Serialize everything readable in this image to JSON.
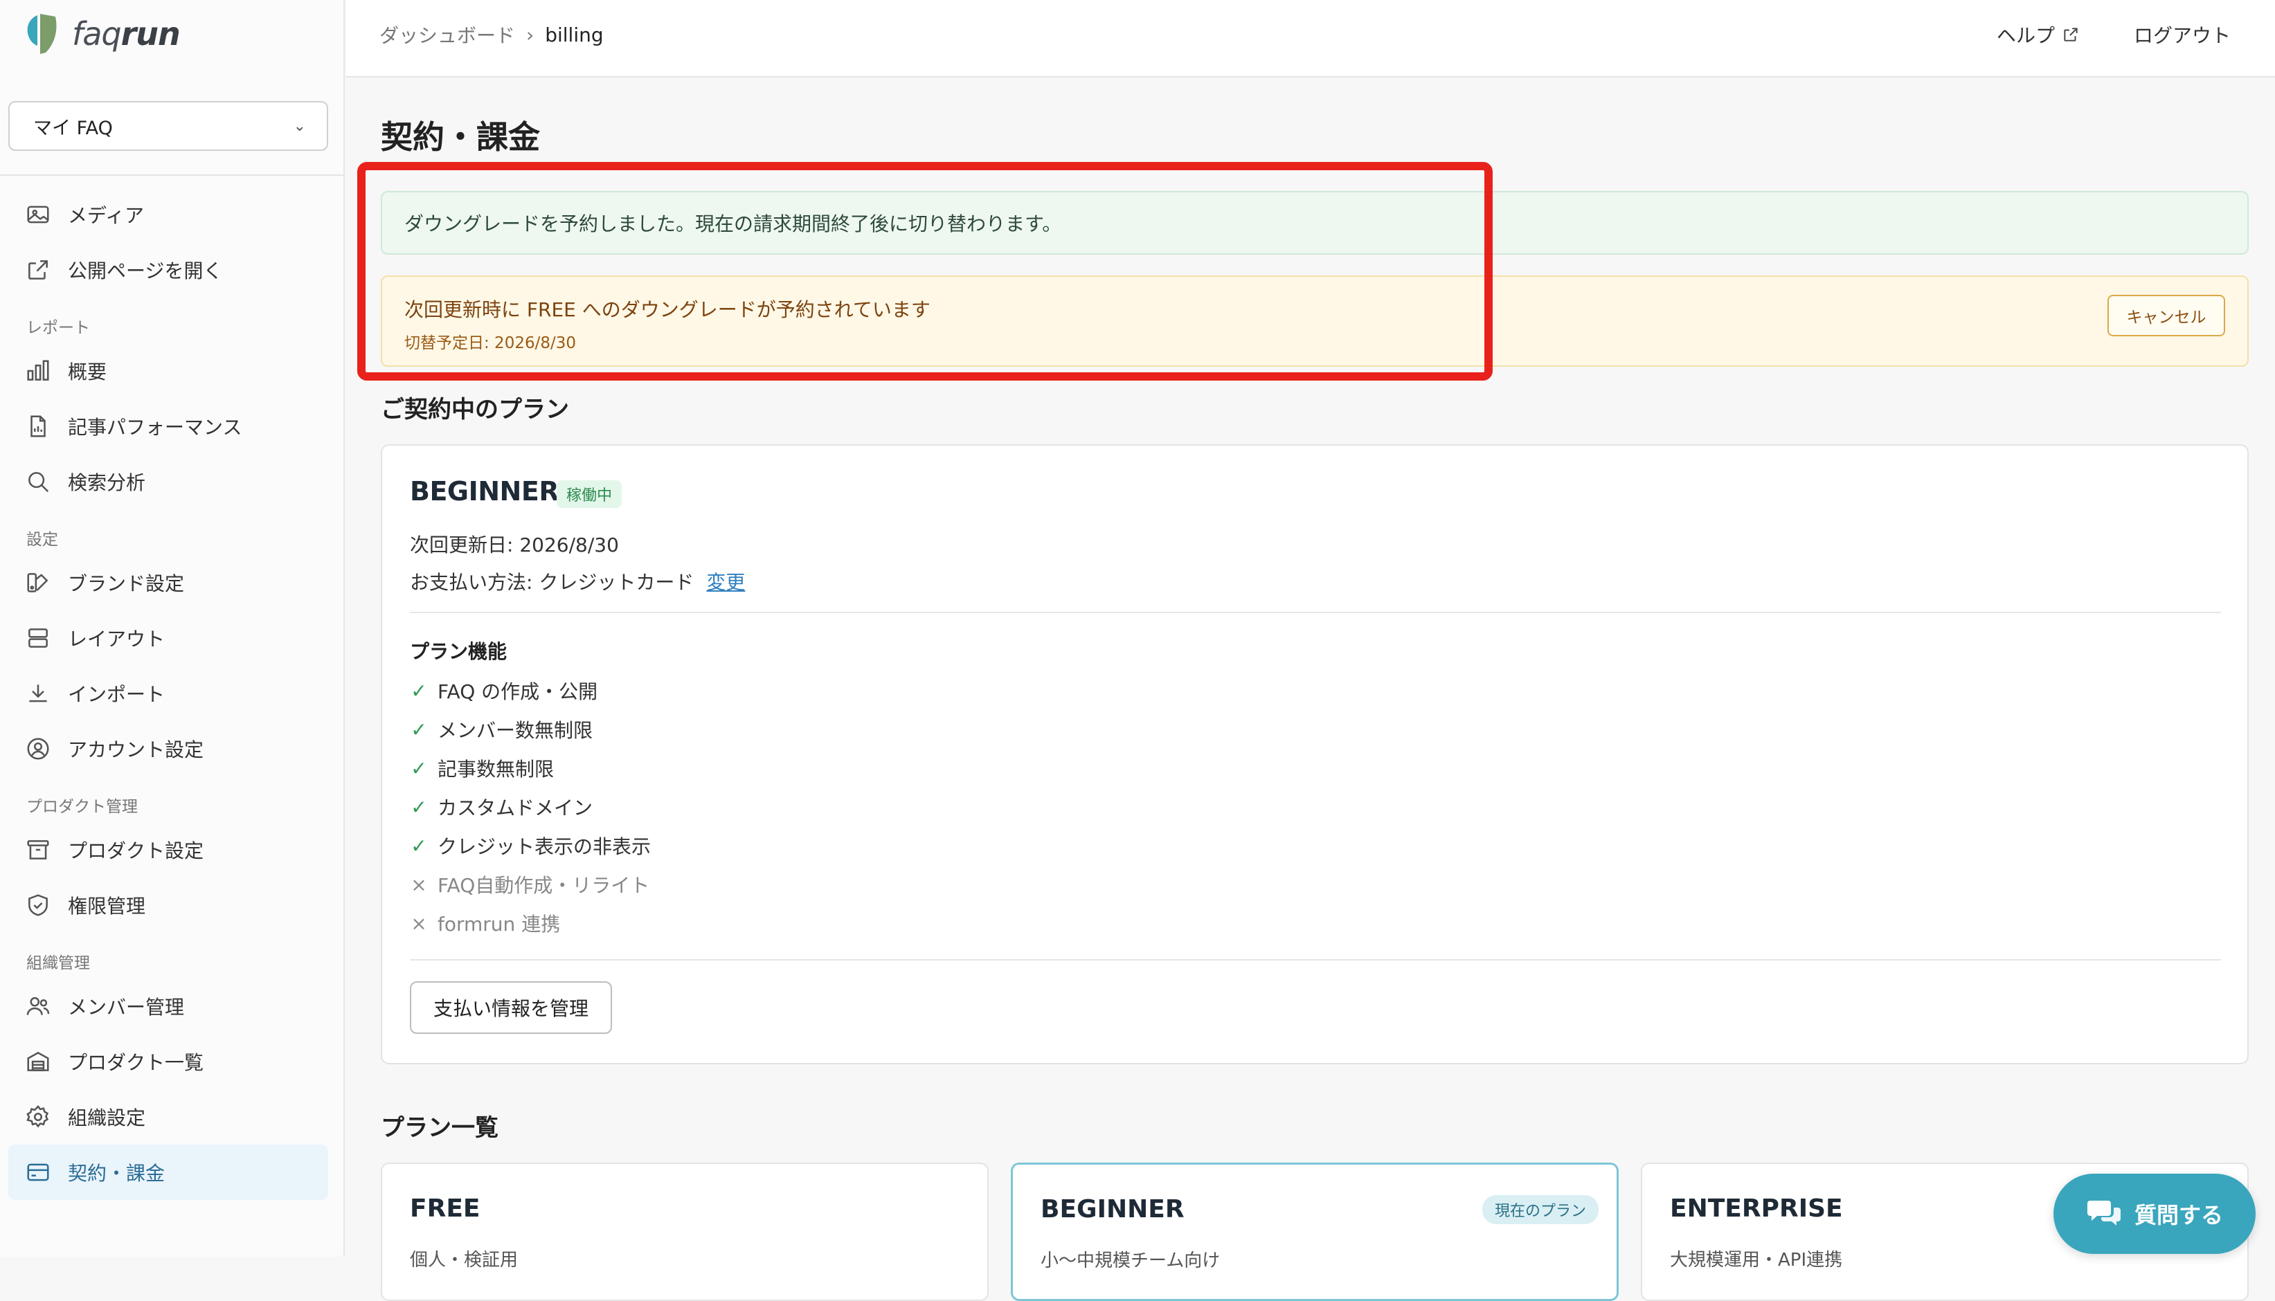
{
  "brand": {
    "logo_text_light": "faq",
    "logo_text_bold": "run",
    "accent": "#3aa6bd"
  },
  "sidebar": {
    "faq_select": {
      "value": "マイ FAQ"
    },
    "items_top": [
      {
        "label": "メディア",
        "icon": "image-icon"
      },
      {
        "label": "公開ページを開く",
        "icon": "external-link-icon"
      }
    ],
    "sections": [
      {
        "title": "レポート",
        "items": [
          {
            "label": "概要",
            "icon": "bar-chart-icon"
          },
          {
            "label": "記事パフォーマンス",
            "icon": "document-chart-icon"
          },
          {
            "label": "検索分析",
            "icon": "search-icon"
          }
        ]
      },
      {
        "title": "設定",
        "items": [
          {
            "label": "ブランド設定",
            "icon": "palette-icon"
          },
          {
            "label": "レイアウト",
            "icon": "layout-icon"
          },
          {
            "label": "インポート",
            "icon": "download-icon"
          },
          {
            "label": "アカウント設定",
            "icon": "user-circle-icon"
          }
        ]
      },
      {
        "title": "プロダクト管理",
        "items": [
          {
            "label": "プロダクト設定",
            "icon": "archive-icon"
          },
          {
            "label": "権限管理",
            "icon": "shield-icon"
          }
        ]
      },
      {
        "title": "組織管理",
        "items": [
          {
            "label": "メンバー管理",
            "icon": "users-icon"
          },
          {
            "label": "プロダクト一覧",
            "icon": "warehouse-icon"
          },
          {
            "label": "組織設定",
            "icon": "gear-icon"
          },
          {
            "label": "契約・課金",
            "icon": "credit-card-icon",
            "active": true
          }
        ]
      }
    ]
  },
  "header": {
    "breadcrumb": [
      "ダッシュボード",
      "billing"
    ],
    "help_label": "ヘルプ",
    "logout_label": "ログアウト"
  },
  "page": {
    "title": "契約・課金",
    "success_alert": "ダウングレードを予約しました。現在の請求期間終了後に切り替わります。",
    "warning_alert": {
      "message": "次回更新時に FREE へのダウングレードが予約されています",
      "date_line": "切替予定日: 2026/8/30",
      "cancel_label": "キャンセル"
    },
    "current_plan_heading": "ご契約中のプラン",
    "current_plan": {
      "name": "BEGINNER",
      "status_badge": "稼働中",
      "renewal": "次回更新日: 2026/8/30",
      "payment_method": "お支払い方法: クレジットカード",
      "change_link": "変更",
      "features_title": "プラン機能",
      "features": [
        {
          "label": "FAQ の作成・公開",
          "included": true
        },
        {
          "label": "メンバー数無制限",
          "included": true
        },
        {
          "label": "記事数無制限",
          "included": true
        },
        {
          "label": "カスタムドメイン",
          "included": true
        },
        {
          "label": "クレジット表示の非表示",
          "included": true
        },
        {
          "label": "FAQ自動作成・リライト",
          "included": false
        },
        {
          "label": "formrun 連携",
          "included": false
        }
      ],
      "manage_button": "支払い情報を管理"
    },
    "plan_list_heading": "プラン一覧",
    "plans": [
      {
        "name": "FREE",
        "sub": "個人・検証用"
      },
      {
        "name": "BEGINNER",
        "badge": "現在のプラン",
        "sub": "小〜中規模チーム向け"
      },
      {
        "name": "ENTERPRISE",
        "sub": "大規模運用・API連携"
      }
    ]
  },
  "chat_button": {
    "label": "質問する"
  }
}
